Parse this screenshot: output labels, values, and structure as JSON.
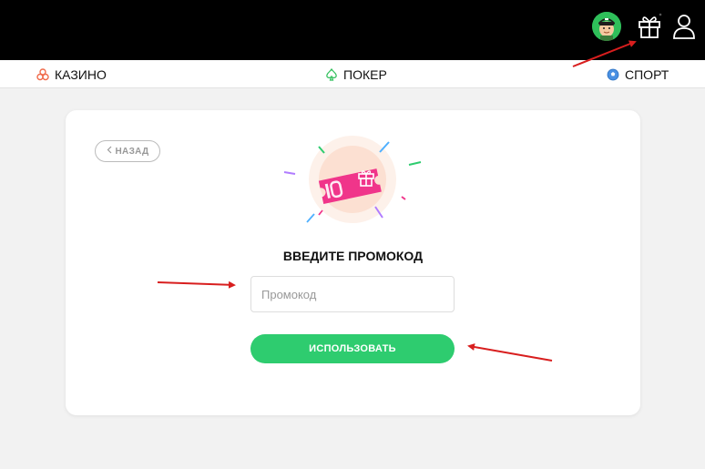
{
  "header": {
    "avatar_icon": "avatar-icon",
    "gift_icon": "gift-icon",
    "profile_icon": "user-icon"
  },
  "nav": {
    "items": [
      {
        "label": "КАЗИНО",
        "icon": "cherries-icon"
      },
      {
        "label": "ПОКЕР",
        "icon": "spade-icon"
      },
      {
        "label": "СПОРТ",
        "icon": "soccer-ball-icon"
      }
    ]
  },
  "promo": {
    "back_label": "НАЗАД",
    "title": "ВВЕДИТЕ ПРОМОКОД",
    "input_placeholder": "Промокод",
    "input_value": "",
    "submit_label": "ИСПОЛЬЗОВАТЬ"
  },
  "colors": {
    "topbar": "#000000",
    "accent_green": "#2ecc6f",
    "ticket_pink": "#f0358a",
    "annotation_red": "#d81e1e"
  }
}
